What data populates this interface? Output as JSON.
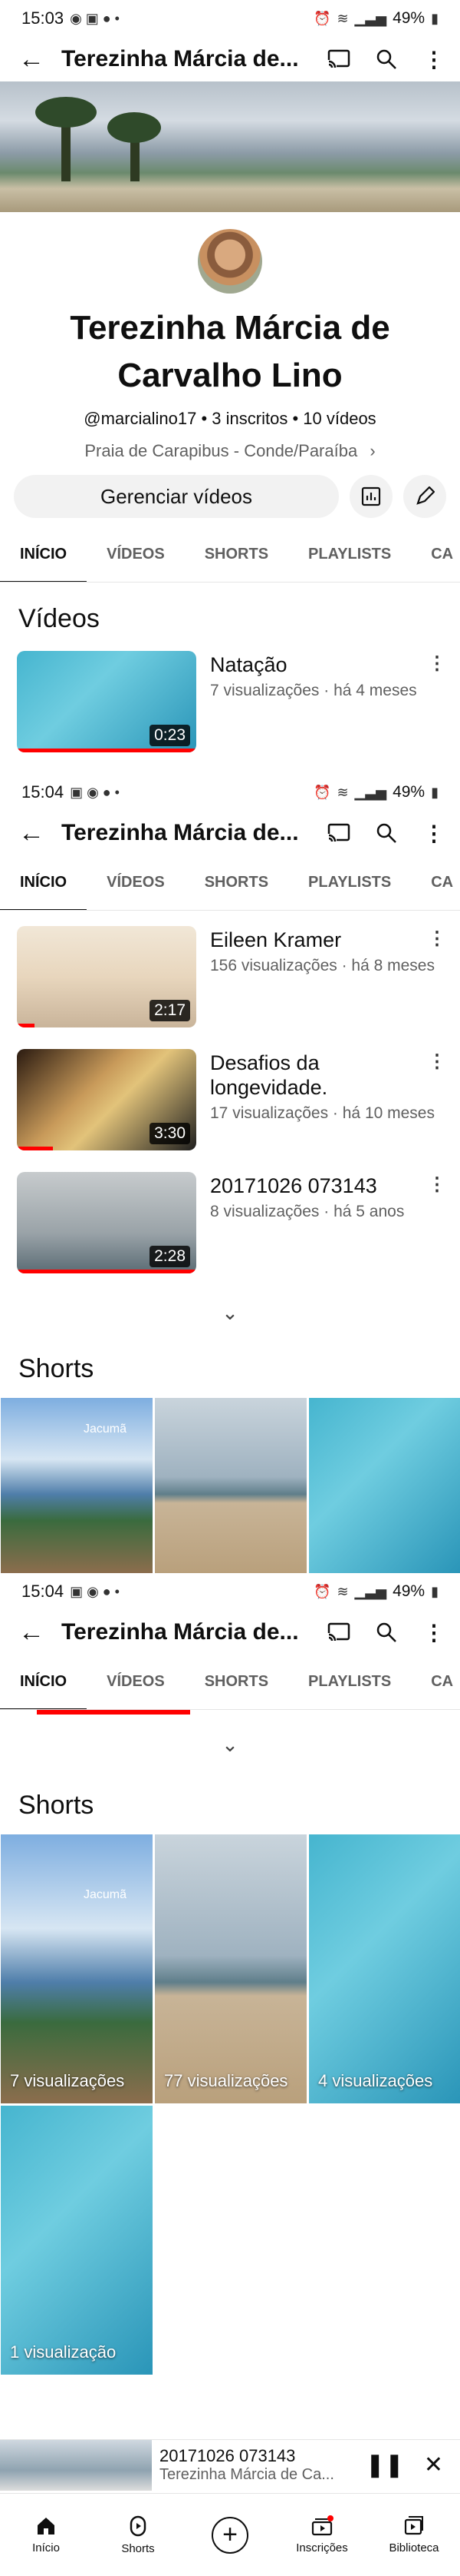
{
  "statusbars": [
    {
      "time": "15:03",
      "battery": "49%"
    },
    {
      "time": "15:04",
      "battery": "49%"
    },
    {
      "time": "15:04",
      "battery": "49%"
    }
  ],
  "channel": {
    "title_truncated": "Terezinha Márcia de...",
    "name_line1": "Terezinha Márcia de",
    "name_line2": "Carvalho Lino",
    "handle": "@marcialino17",
    "subscribers": "3 inscritos",
    "videos_count": "10 vídeos",
    "location": "Praia de Carapibus - Conde/Paraíba",
    "manage_label": "Gerenciar vídeos"
  },
  "tabs": [
    "INÍCIO",
    "VÍDEOS",
    "SHORTS",
    "PLAYLISTS",
    "CA"
  ],
  "videos_title": "Vídeos",
  "videos": [
    {
      "title": "Natação",
      "meta": "7 visualizações · há 4 meses",
      "duration": "0:23"
    },
    {
      "title": "Eileen Kramer",
      "meta": "156 visualizações · há 8 meses",
      "duration": "2:17"
    },
    {
      "title": "Desafios da longevidade.",
      "meta": "17 visualizações · há 10 meses",
      "duration": "3:30"
    },
    {
      "title": "20171026 073143",
      "meta": "8 visualizações · há 5 anos",
      "duration": "2:28"
    }
  ],
  "shorts_title": "Shorts",
  "shorts_preview_label": "Jacumã",
  "shorts": [
    {
      "views": "7 visualizações"
    },
    {
      "views": "77 visualizações"
    },
    {
      "views": "4 visualizações"
    },
    {
      "views": "1 visualização"
    }
  ],
  "mini_player": {
    "title": "20171026 073143",
    "subtitle": "Terezinha Márcia de Ca..."
  },
  "nav": {
    "home": "Início",
    "shorts": "Shorts",
    "subs": "Inscrições",
    "library": "Biblioteca"
  }
}
